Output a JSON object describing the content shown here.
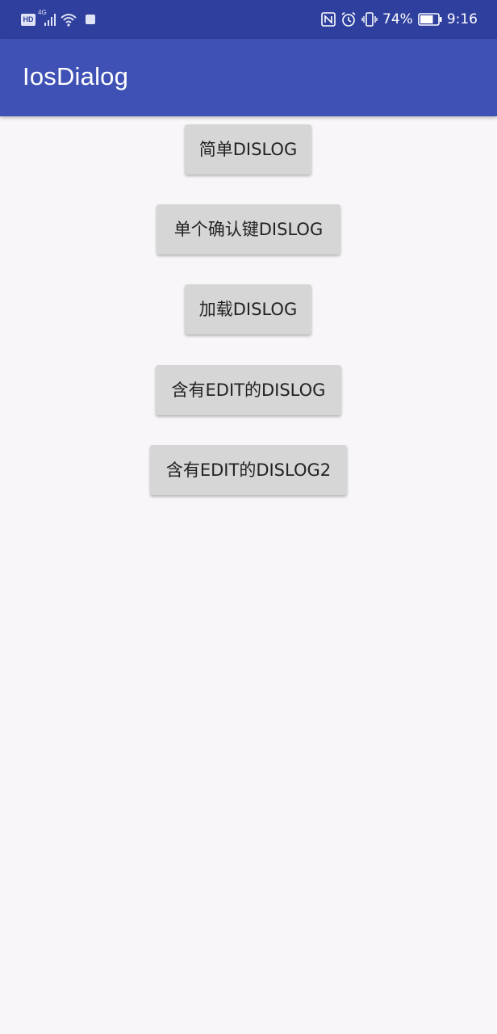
{
  "status_bar": {
    "network_badge": "HD",
    "signal_label": "4G",
    "battery_percent": "74%",
    "time": "9:16"
  },
  "app_bar": {
    "title": "IosDialog"
  },
  "buttons": [
    {
      "label": "简单DISLOG"
    },
    {
      "label": "单个确认键DISLOG"
    },
    {
      "label": "加载DISLOG"
    },
    {
      "label": "含有EDIT的DISLOG"
    },
    {
      "label": "含有EDIT的DISLOG2"
    }
  ],
  "colors": {
    "status_bar": "#2f3f9e",
    "app_bar": "#3f51b5",
    "background": "#f8f6f9",
    "button": "#d6d6d6",
    "button_text": "#222222"
  }
}
